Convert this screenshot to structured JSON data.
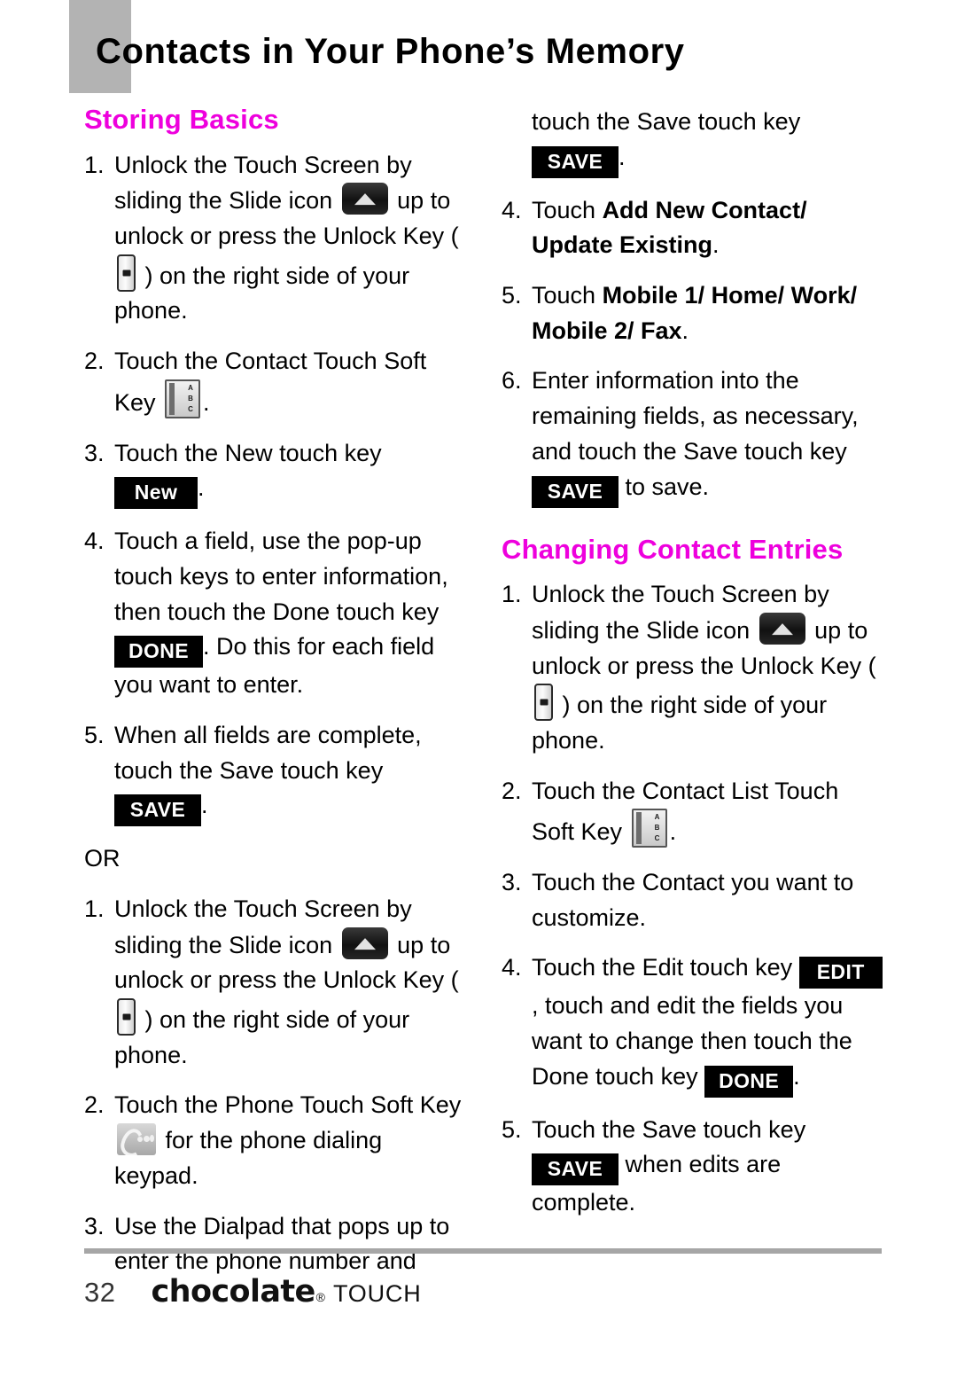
{
  "page": {
    "title": "Contacts in Your Phone’s Memory",
    "number": "32",
    "accent_color": "#EE00DD",
    "tab_color": "#B3B3B3"
  },
  "brand": {
    "name": "chocolate",
    "registered_mark": "®",
    "suffix": "TOUCH"
  },
  "left_column": {
    "heading": "Storing Basics",
    "steps": [
      {
        "num": "1.",
        "parts": [
          {
            "type": "text",
            "value": "Unlock the Touch Screen by sliding the Slide icon "
          },
          {
            "type": "icon",
            "value": "slide-icon"
          },
          {
            "type": "text",
            "value": " up to unlock or press the Unlock Key ( "
          },
          {
            "type": "icon",
            "value": "unlock-key-icon"
          },
          {
            "type": "text",
            "value": " ) on the right side of your phone."
          }
        ]
      },
      {
        "num": "2.",
        "parts": [
          {
            "type": "text",
            "value": "Touch the Contact Touch Soft Key "
          },
          {
            "type": "icon",
            "value": "contacts-icon"
          },
          {
            "type": "text",
            "value": "."
          }
        ]
      },
      {
        "num": "3.",
        "parts": [
          {
            "type": "text",
            "value": "Touch the New touch key "
          },
          {
            "type": "badge",
            "value": "New"
          },
          {
            "type": "text",
            "value": "."
          }
        ]
      },
      {
        "num": "4.",
        "parts": [
          {
            "type": "text",
            "value": "Touch a field, use the pop-up touch keys to enter information, then touch the Done touch key "
          },
          {
            "type": "badge",
            "value": "DONE"
          },
          {
            "type": "text",
            "value": ". Do this for each field you want to enter."
          }
        ]
      },
      {
        "num": "5.",
        "parts": [
          {
            "type": "text",
            "value": "When all fields are complete, touch the Save touch key "
          },
          {
            "type": "badge",
            "value": "SAVE"
          },
          {
            "type": "text",
            "value": "."
          }
        ]
      }
    ],
    "or_label": "OR",
    "alt_steps": [
      {
        "num": "1.",
        "parts": [
          {
            "type": "text",
            "value": "Unlock the Touch Screen by sliding the Slide icon "
          },
          {
            "type": "icon",
            "value": "slide-icon"
          },
          {
            "type": "text",
            "value": " up to unlock or press the Unlock Key ( "
          },
          {
            "type": "icon",
            "value": "unlock-key-icon"
          },
          {
            "type": "text",
            "value": " ) on the right side of your phone."
          }
        ]
      },
      {
        "num": "2.",
        "parts": [
          {
            "type": "text",
            "value": "Touch the Phone Touch Soft Key "
          },
          {
            "type": "icon",
            "value": "phone-icon"
          },
          {
            "type": "text",
            "value": " for the phone dialing keypad."
          }
        ]
      },
      {
        "num": "3.",
        "parts": [
          {
            "type": "text",
            "value": "Use the Dialpad that pops up to enter the phone number and"
          }
        ]
      }
    ]
  },
  "right_column": {
    "continued_step": {
      "parts": [
        {
          "type": "text",
          "value": "touch the Save touch key "
        },
        {
          "type": "badge",
          "value": "SAVE"
        },
        {
          "type": "text",
          "value": "."
        }
      ]
    },
    "steps": [
      {
        "num": "4.",
        "parts": [
          {
            "type": "text",
            "value": "Touch "
          },
          {
            "type": "bold",
            "value": "Add New Contact/ Update Existing"
          },
          {
            "type": "text",
            "value": "."
          }
        ]
      },
      {
        "num": "5.",
        "parts": [
          {
            "type": "text",
            "value": "Touch "
          },
          {
            "type": "bold",
            "value": "Mobile 1/ Home/ Work/ Mobile 2/ Fax"
          },
          {
            "type": "text",
            "value": "."
          }
        ]
      },
      {
        "num": "6.",
        "parts": [
          {
            "type": "text",
            "value": "Enter information into the remaining fields, as necessary, and touch the Save touch key "
          },
          {
            "type": "badge",
            "value": "SAVE"
          },
          {
            "type": "text",
            "value": " to save."
          }
        ]
      }
    ],
    "heading": "Changing Contact Entries",
    "change_steps": [
      {
        "num": "1.",
        "parts": [
          {
            "type": "text",
            "value": "Unlock the Touch Screen by sliding the Slide icon "
          },
          {
            "type": "icon",
            "value": "slide-icon"
          },
          {
            "type": "text",
            "value": " up to unlock or press the Unlock Key ( "
          },
          {
            "type": "icon",
            "value": "unlock-key-icon"
          },
          {
            "type": "text",
            "value": " ) on the right side of your phone."
          }
        ]
      },
      {
        "num": "2.",
        "parts": [
          {
            "type": "text",
            "value": "Touch the Contact List Touch Soft Key "
          },
          {
            "type": "icon",
            "value": "contacts-icon"
          },
          {
            "type": "text",
            "value": "."
          }
        ]
      },
      {
        "num": "3.",
        "parts": [
          {
            "type": "text",
            "value": "Touch the Contact you want to customize."
          }
        ]
      },
      {
        "num": "4.",
        "parts": [
          {
            "type": "text",
            "value": "Touch the Edit touch key "
          },
          {
            "type": "badge",
            "value": "EDIT"
          },
          {
            "type": "text",
            "value": ",  touch and edit the fields you want to change then touch the Done touch key "
          },
          {
            "type": "badge",
            "value": "DONE"
          },
          {
            "type": "text",
            "value": "."
          }
        ]
      },
      {
        "num": "5.",
        "parts": [
          {
            "type": "text",
            "value": "Touch the Save touch key "
          },
          {
            "type": "badge",
            "value": "SAVE"
          },
          {
            "type": "text",
            "value": " when edits are complete."
          }
        ]
      }
    ]
  },
  "icons": {
    "slide-icon": "slide-up-arrow",
    "unlock-key-icon": "side-unlock-key",
    "contacts-icon": "address-book",
    "phone-icon": "phone-handset"
  }
}
